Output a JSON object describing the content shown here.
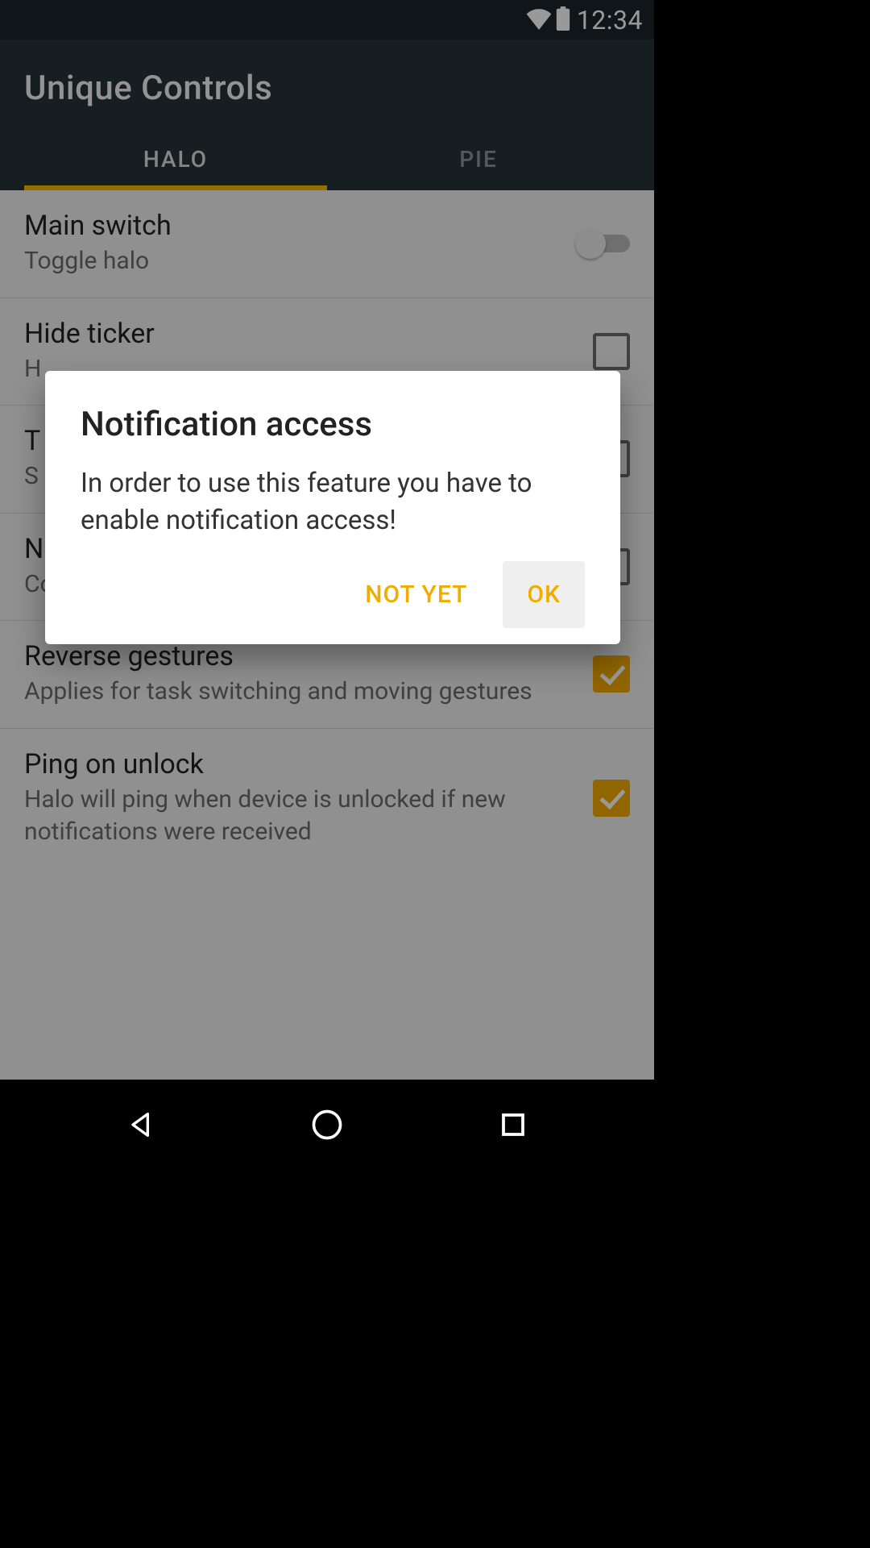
{
  "status": {
    "time": "12:34"
  },
  "app": {
    "title": "Unique Controls",
    "tabs": [
      {
        "label": "HALO",
        "active": true
      },
      {
        "label": "PIE",
        "active": false
      }
    ]
  },
  "settings": [
    {
      "title": "Main switch",
      "sub": "Toggle halo",
      "ctl": "switch",
      "checked": false
    },
    {
      "title": "Hide ticker",
      "sub": "H",
      "ctl": "checkbox",
      "checked": false
    },
    {
      "title": "T",
      "sub": "S",
      "ctl": "checkbox",
      "checked": false
    },
    {
      "title": "N",
      "sub": "Completely hides halo while empty",
      "ctl": "checkbox",
      "checked": false
    },
    {
      "title": "Reverse gestures",
      "sub": "Applies for task switching and moving gestures",
      "ctl": "checkbox",
      "checked": true
    },
    {
      "title": "Ping on unlock",
      "sub": "Halo will ping when device is unlocked if new notifications were received",
      "ctl": "checkbox",
      "checked": true
    }
  ],
  "dialog": {
    "title": "Notification access",
    "body": "In order to use this feature you have to enable notification access!",
    "negative": "NOT YET",
    "positive": "OK"
  }
}
